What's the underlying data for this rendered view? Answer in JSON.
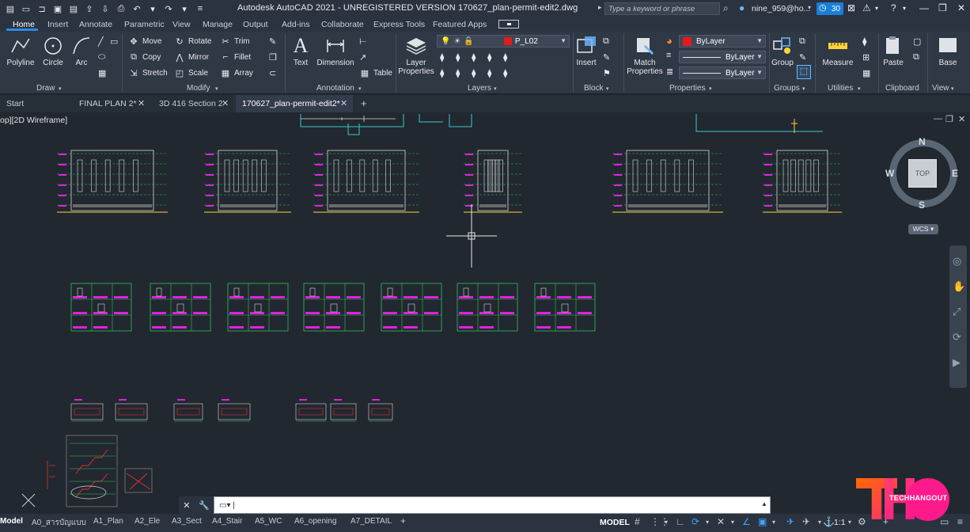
{
  "title_bar": {
    "app_title": "Autodesk AutoCAD 2021 - UNREGISTERED VERSION    170627_plan-permit-edit2.dwg",
    "search_placeholder": "Type a keyword or phrase",
    "user_name": "nine_959@ho...",
    "timer_badge": "30"
  },
  "ribbon_tabs": [
    "Home",
    "Insert",
    "Annotate",
    "Parametric",
    "View",
    "Manage",
    "Output",
    "Add-ins",
    "Collaborate",
    "Express Tools",
    "Featured Apps"
  ],
  "ribbon": {
    "draw": {
      "label": "Draw",
      "polyline": "Polyline",
      "circle": "Circle",
      "arc": "Arc"
    },
    "modify": {
      "label": "Modify",
      "move": "Move",
      "rotate": "Rotate",
      "trim": "Trim",
      "copy": "Copy",
      "mirror": "Mirror",
      "fillet": "Fillet",
      "stretch": "Stretch",
      "scale": "Scale",
      "array": "Array"
    },
    "annotation": {
      "label": "Annotation",
      "text": "Text",
      "dimension": "Dimension",
      "table": "Table"
    },
    "layers": {
      "label": "Layers",
      "layer_properties_1": "Layer",
      "layer_properties_2": "Properties",
      "current_layer": "P_L02"
    },
    "block": {
      "label": "Block",
      "insert": "Insert"
    },
    "properties": {
      "label": "Properties",
      "match_1": "Match",
      "match_2": "Properties",
      "color": "ByLayer",
      "linetype": "ByLayer",
      "lineweight": "ByLayer"
    },
    "groups": {
      "label": "Groups",
      "group": "Group"
    },
    "utilities": {
      "label": "Utilities",
      "measure": "Measure"
    },
    "clipboard": {
      "label": "Clipboard",
      "paste": "Paste"
    },
    "view": {
      "label": "View",
      "base": "Base"
    }
  },
  "file_tabs": [
    {
      "label": "Start"
    },
    {
      "label": "FINAL PLAN 2*"
    },
    {
      "label": "3D 416 Section 2"
    },
    {
      "label": "170627_plan-permit-edit2*"
    }
  ],
  "viewport": {
    "label": "op][2D Wireframe]"
  },
  "viewcube": {
    "top": "TOP",
    "n": "N",
    "s": "S",
    "w": "W",
    "e": "E",
    "wcs": "WCS"
  },
  "layout_tabs": [
    "Model",
    "A0_สารบัญแบบ",
    "A1_Plan",
    "A2_Ele",
    "A3_Sect",
    "A4_Stair",
    "A5_WC",
    "A6_opening",
    "A7_DETAIL"
  ],
  "status_bar": {
    "model": "MODEL",
    "scale": "1:1"
  },
  "watermark": {
    "text": "TECHHANGOUT"
  },
  "colors": {
    "accent": "#2e8be6",
    "layer_color": "#e21b1b",
    "drawing_green": "#34c05a",
    "drawing_magenta": "#e020e0"
  }
}
